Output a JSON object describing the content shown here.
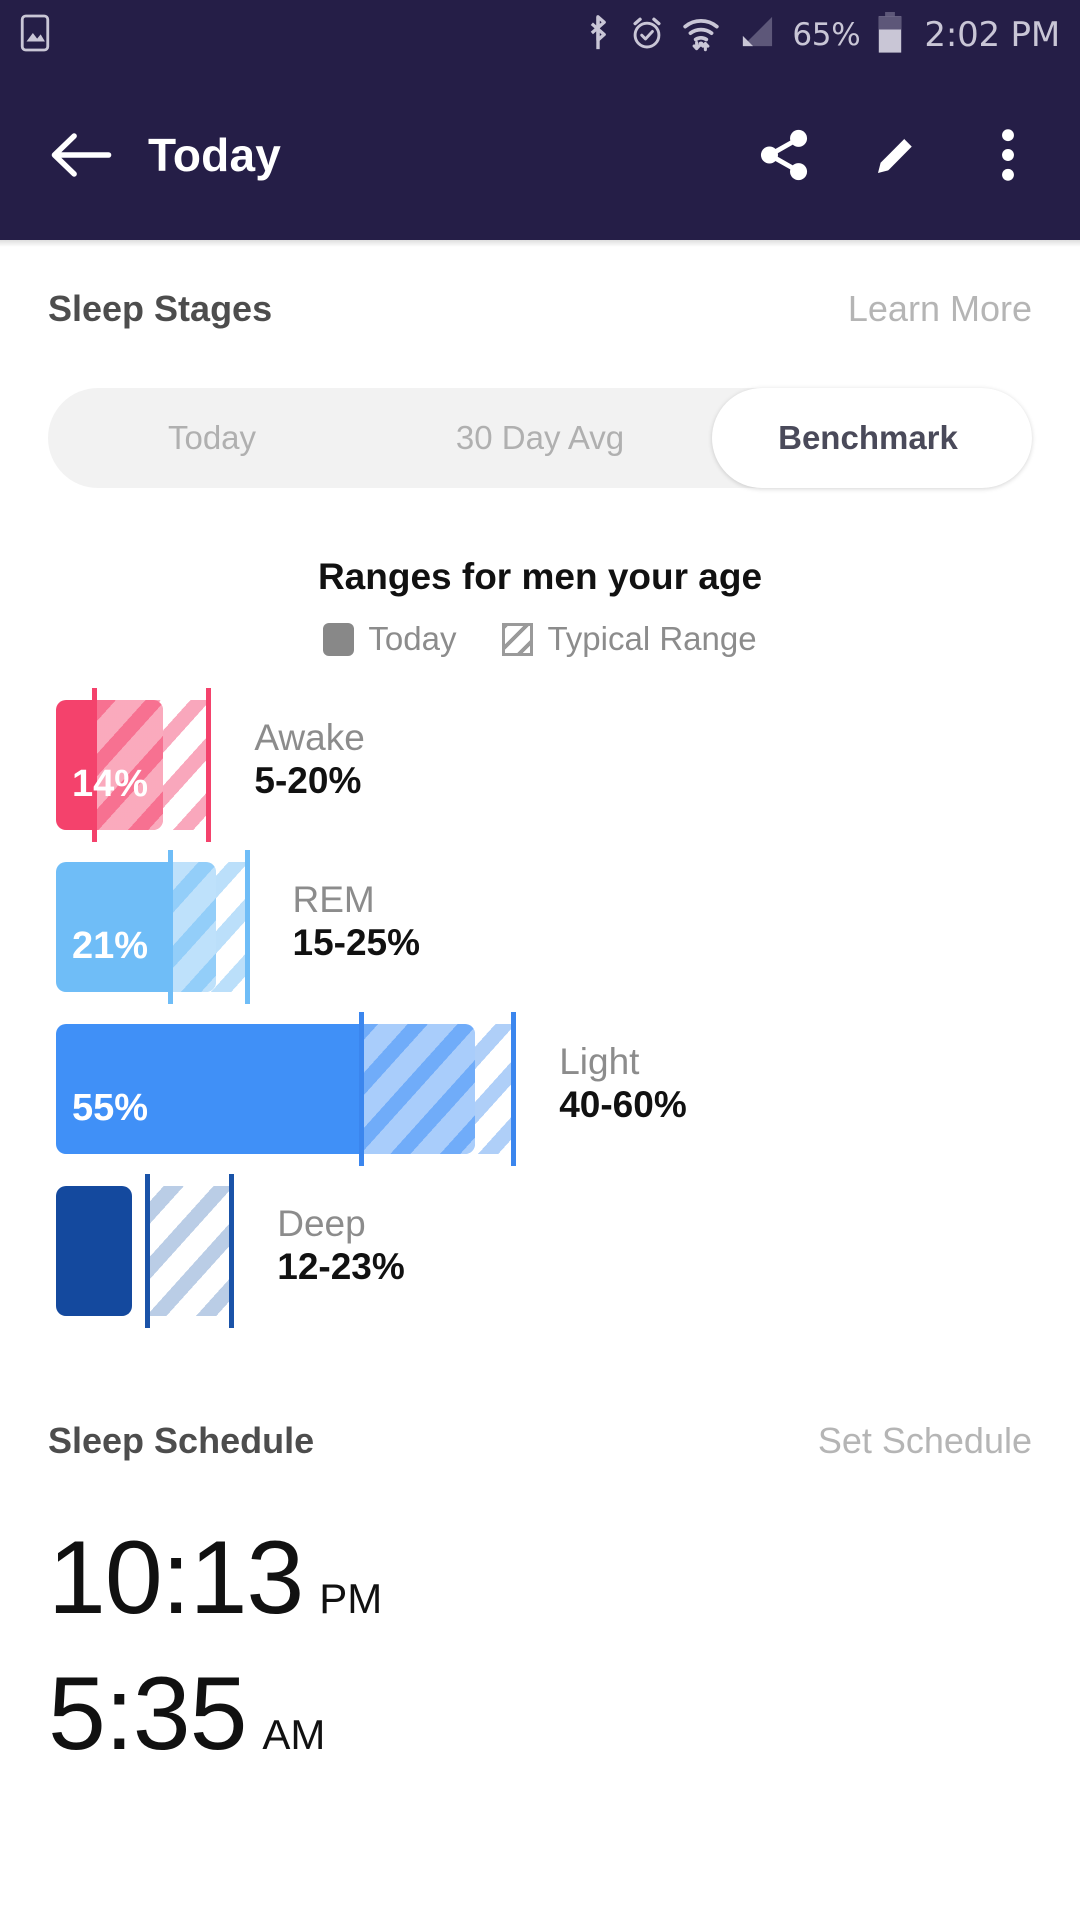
{
  "statusbar": {
    "icons": [
      "screenshot-icon",
      "bluetooth-icon",
      "alarm-icon",
      "wifi-icon",
      "cellular-signal-icon"
    ],
    "battery_percent": "65%",
    "time": "2:02 PM"
  },
  "appbar": {
    "back_label": "back-arrow",
    "title": "Today",
    "actions": [
      "share-icon",
      "edit-icon",
      "overflow-menu-icon"
    ]
  },
  "sleep_stages": {
    "title": "Sleep Stages",
    "learn_more": "Learn More",
    "tabs": [
      {
        "label": "Today",
        "active": false
      },
      {
        "label": "30 Day Avg",
        "active": false
      },
      {
        "label": "Benchmark",
        "active": true
      }
    ]
  },
  "legend": {
    "today_label": "Today",
    "typical_label": "Typical Range"
  },
  "chart_data": {
    "type": "bar",
    "title": "Ranges for men your age",
    "orientation": "horizontal",
    "xlabel": "",
    "ylabel": "",
    "xlim": [
      0,
      65
    ],
    "unit": "%",
    "grid": false,
    "legend": [
      "Today",
      "Typical Range"
    ],
    "categories": [
      "Awake",
      "REM",
      "Light",
      "Deep"
    ],
    "series": [
      {
        "name": "Today",
        "values": [
          14,
          21,
          55,
          10
        ]
      },
      {
        "name": "Typical Range low",
        "values": [
          5,
          15,
          40,
          12
        ]
      },
      {
        "name": "Typical Range high",
        "values": [
          20,
          25,
          60,
          23
        ]
      }
    ],
    "bars": [
      {
        "name": "Awake",
        "value": 14,
        "value_label": "14%",
        "show_value_label": true,
        "range_label": "5-20%",
        "range_low": 5,
        "range_high": 20,
        "color": "#F4426C",
        "hatch_color": "#F9A7BC",
        "line_color": "#F4426C"
      },
      {
        "name": "REM",
        "value": 21,
        "value_label": "21%",
        "show_value_label": true,
        "range_label": "15-25%",
        "range_low": 15,
        "range_high": 25,
        "color": "#6FBDF7",
        "hatch_color": "#BBDFFA",
        "line_color": "#6FBDF7"
      },
      {
        "name": "Light",
        "value": 55,
        "value_label": "55%",
        "show_value_label": true,
        "range_label": "40-60%",
        "range_low": 40,
        "range_high": 60,
        "color": "#4090F7",
        "hatch_color": "#AFCFF8",
        "line_color": "#3B86EE"
      },
      {
        "name": "Deep",
        "value": 10,
        "value_label": "",
        "show_value_label": false,
        "range_label": "12-23%",
        "range_low": 12,
        "range_high": 23,
        "color": "#14499E",
        "hatch_color": "#BACDE6",
        "line_color": "#1A53A8"
      }
    ]
  },
  "sleep_schedule": {
    "title": "Sleep Schedule",
    "action": "Set Schedule",
    "bedtime": {
      "time": "10:13",
      "meridiem": "PM"
    },
    "waketime": {
      "time": "5:35",
      "meridiem": "AM"
    }
  }
}
